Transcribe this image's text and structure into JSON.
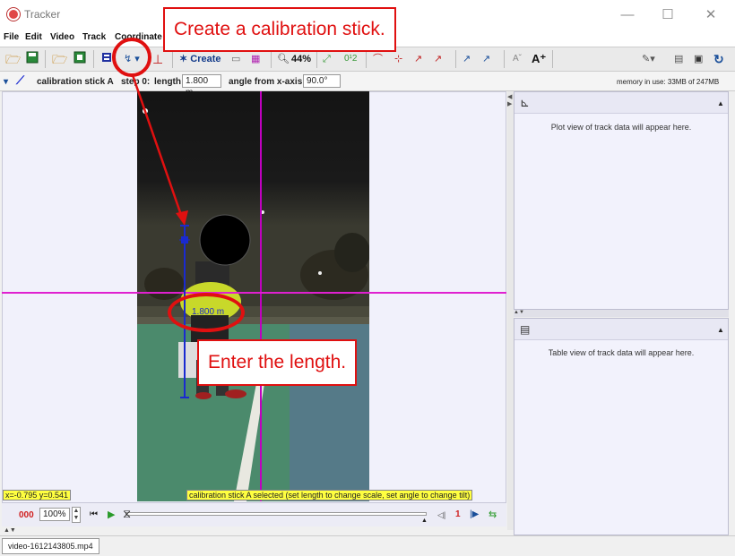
{
  "window": {
    "title": "Tracker",
    "minimize": "—",
    "maximize": "☐",
    "close": "✕"
  },
  "menu": [
    "File",
    "Edit",
    "Video",
    "Track",
    "Coordinate"
  ],
  "toolbar": {
    "create_label": "✶ Create",
    "zoom": "44%",
    "o12": "0¹2"
  },
  "track": {
    "name": "calibration stick A",
    "step_label": "step 0:",
    "length_label": "length",
    "length_value": "1.800 m",
    "angle_label": "angle from x-axis",
    "angle_value": "90.0°",
    "memory": "memory in use: 33MB of 247MB"
  },
  "status": {
    "coords": "x=-0.795  y=0.541",
    "message": "calibration stick A selected (set length to change scale, set angle to change tilt)"
  },
  "player": {
    "frame": "000",
    "zoom": "100%",
    "step_count": "1"
  },
  "plot_panel": {
    "text": "Plot view of track data will appear here."
  },
  "table_panel": {
    "text": "Table view of track data will appear here."
  },
  "file_tab": "video-1612143805.mp4",
  "annotations": {
    "top": "Create a calibration stick.",
    "bottom": "Enter the length."
  },
  "colors": {
    "accent": "#e01010",
    "axis": "#c000c0",
    "stick": "#1a2ad0",
    "status_bg": "#ffff40"
  }
}
